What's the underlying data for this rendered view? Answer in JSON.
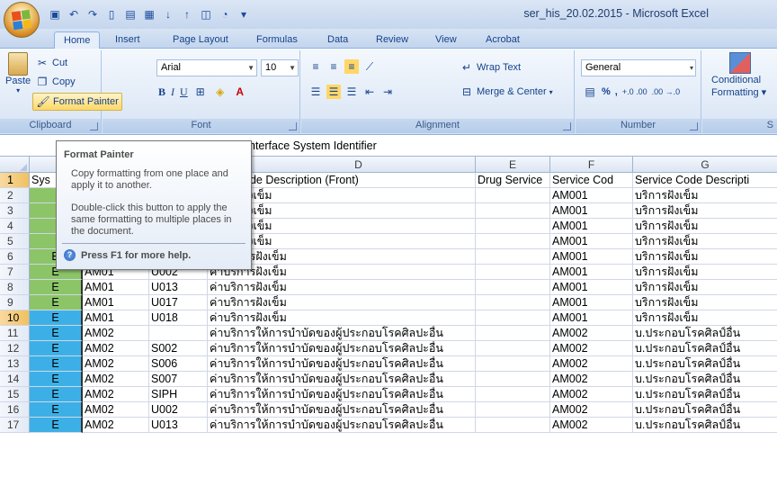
{
  "window": {
    "title": "ser_his_20.02.2015 - Microsoft Excel"
  },
  "tabs": [
    {
      "label": "Home",
      "active": true
    },
    {
      "label": "Insert"
    },
    {
      "label": "Page Layout"
    },
    {
      "label": "Formulas"
    },
    {
      "label": "Data"
    },
    {
      "label": "Review"
    },
    {
      "label": "View"
    },
    {
      "label": "Acrobat"
    }
  ],
  "ribbon": {
    "clipboard": {
      "label": "Clipboard",
      "paste": "Paste",
      "cut": "Cut",
      "copy": "Copy",
      "format_painter": "Format Painter"
    },
    "font": {
      "label": "Font",
      "name": "Arial",
      "size": "10",
      "bold": "B",
      "italic": "I",
      "underline": "U"
    },
    "alignment": {
      "label": "Alignment",
      "wrap_text": "Wrap Text",
      "merge_center": "Merge & Center"
    },
    "number": {
      "label": "Number",
      "format": "General",
      "percent": "%",
      "comma": ",",
      "inc_decimal": "+.0 .00",
      "dec_decimal": ".00 →.0"
    },
    "styles": {
      "conditional": "Conditional",
      "formatting": "Formatting ▾"
    }
  },
  "formula_bar": {
    "content": "nterface System Identifier"
  },
  "columns": [
    {
      "letter": "",
      "selected": false
    },
    {
      "letter": "D",
      "selected": false
    },
    {
      "letter": "E",
      "selected": false
    },
    {
      "letter": "F",
      "selected": false
    },
    {
      "letter": "G",
      "selected": false
    }
  ],
  "tooltip": {
    "title": "Format Painter",
    "p1": "Copy formatting from one place and apply it to another.",
    "p2": "Double-click this button to apply the same formatting to multiple places in the document.",
    "help": "Press F1 for more help."
  },
  "header_row": {
    "a": "Sys",
    "d": "ode Description (Front)",
    "e": "Drug Service",
    "f": "Service Cod",
    "g": "Service Code Descripti"
  },
  "rows": [
    {
      "n": "2",
      "a": "",
      "b": "",
      "c": "",
      "d": "าริการฝังเข็ม",
      "f": "AM001",
      "g": "บริการฝังเข็ม",
      "color": "green"
    },
    {
      "n": "3",
      "a": "",
      "b": "",
      "c": "",
      "d": "าริการฝังเข็ม",
      "f": "AM001",
      "g": "บริการฝังเข็ม",
      "color": "green"
    },
    {
      "n": "4",
      "a": "",
      "b": "",
      "c": "",
      "d": "าริการฝังเข็ม",
      "f": "AM001",
      "g": "บริการฝังเข็ม",
      "color": "green"
    },
    {
      "n": "5",
      "a": "",
      "b": "",
      "c": "",
      "d": "าริการฝังเข็ม",
      "f": "AM001",
      "g": "บริการฝังเข็ม",
      "color": "green"
    },
    {
      "n": "6",
      "a": "E",
      "b": "AM01",
      "c": "SIPH",
      "d": "ค่าบริการฝังเข็ม",
      "f": "AM001",
      "g": "บริการฝังเข็ม",
      "color": "green"
    },
    {
      "n": "7",
      "a": "E",
      "b": "AM01",
      "c": "U002",
      "d": "ค่าบริการฝังเข็ม",
      "f": "AM001",
      "g": "บริการฝังเข็ม",
      "color": "green"
    },
    {
      "n": "8",
      "a": "E",
      "b": "AM01",
      "c": "U013",
      "d": "ค่าบริการฝังเข็ม",
      "f": "AM001",
      "g": "บริการฝังเข็ม",
      "color": "green"
    },
    {
      "n": "9",
      "a": "E",
      "b": "AM01",
      "c": "U017",
      "d": "ค่าบริการฝังเข็ม",
      "f": "AM001",
      "g": "บริการฝังเข็ม",
      "color": "green"
    },
    {
      "n": "10",
      "a": "E",
      "b": "AM01",
      "c": "U018",
      "d": "ค่าบริการฝังเข็ม",
      "f": "AM001",
      "g": "บริการฝังเข็ม",
      "color": "blue"
    },
    {
      "n": "11",
      "a": "E",
      "b": "AM02",
      "c": "",
      "d": "ค่าบริการให้การบำบัดของผู้ประกอบโรคศิลปะอื่น",
      "f": "AM002",
      "g": "บ.ประกอบโรคศิลป์อื่น",
      "color": "blue"
    },
    {
      "n": "12",
      "a": "E",
      "b": "AM02",
      "c": "S002",
      "d": "ค่าบริการให้การบำบัดของผู้ประกอบโรคศิลปะอื่น",
      "f": "AM002",
      "g": "บ.ประกอบโรคศิลป์อื่น",
      "color": "blue"
    },
    {
      "n": "13",
      "a": "E",
      "b": "AM02",
      "c": "S006",
      "d": "ค่าบริการให้การบำบัดของผู้ประกอบโรคศิลปะอื่น",
      "f": "AM002",
      "g": "บ.ประกอบโรคศิลป์อื่น",
      "color": "blue"
    },
    {
      "n": "14",
      "a": "E",
      "b": "AM02",
      "c": "S007",
      "d": "ค่าบริการให้การบำบัดของผู้ประกอบโรคศิลปะอื่น",
      "f": "AM002",
      "g": "บ.ประกอบโรคศิลป์อื่น",
      "color": "blue"
    },
    {
      "n": "15",
      "a": "E",
      "b": "AM02",
      "c": "SIPH",
      "d": "ค่าบริการให้การบำบัดของผู้ประกอบโรคศิลปะอื่น",
      "f": "AM002",
      "g": "บ.ประกอบโรคศิลป์อื่น",
      "color": "blue"
    },
    {
      "n": "16",
      "a": "E",
      "b": "AM02",
      "c": "U002",
      "d": "ค่าบริการให้การบำบัดของผู้ประกอบโรคศิลปะอื่น",
      "f": "AM002",
      "g": "บ.ประกอบโรคศิลป์อื่น",
      "color": "blue"
    },
    {
      "n": "17",
      "a": "E",
      "b": "AM02",
      "c": "U013",
      "d": "ค่าบริการให้การบำบัดของผู้ประกอบโรคศิลปะอื่น",
      "f": "AM002",
      "g": "บ.ประกอบโรคศิลป์อื่น",
      "color": "blue"
    }
  ],
  "colors": {
    "green": "#8cc468",
    "blue": "#3cb0e6",
    "accent": "#15428b"
  }
}
